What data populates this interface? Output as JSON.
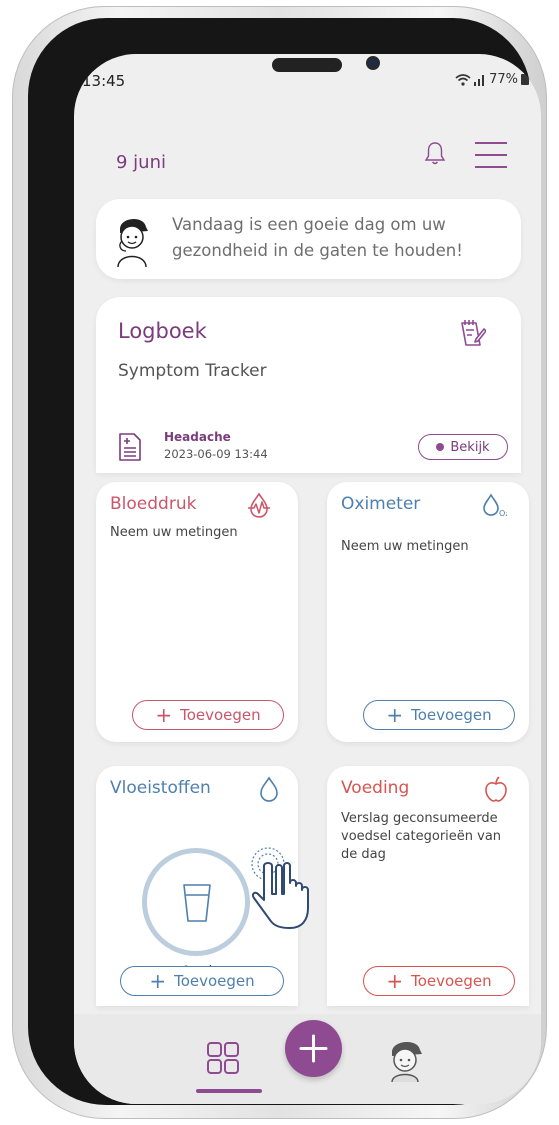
{
  "status_bar": {
    "time": "13:45",
    "battery": "77%"
  },
  "header": {
    "date": "9 juni"
  },
  "greeting": {
    "text": "Vandaag is een goeie dag om uw gezondheid in de gaten te houden!"
  },
  "logbook": {
    "title": "Logboek",
    "subtitle": "Symptom Tracker",
    "entry": {
      "name": "Headache",
      "datetime": "2023-06-09 13:44"
    },
    "view_label": "Bekijk"
  },
  "tiles": {
    "blood_pressure": {
      "title": "Bloeddruk",
      "description": "Neem uw metingen",
      "add_label": "Toevoegen",
      "color": "#c9566a"
    },
    "oximeter": {
      "title": "Oximeter",
      "description": "Neem uw metingen",
      "add_label": "Toevoegen",
      "color": "#4e7fae"
    },
    "fluids": {
      "title": "Vloeistoffen",
      "amount": "0 ml",
      "add_label": "Toevoegen",
      "color": "#4e7fae"
    },
    "nutrition": {
      "title": "Voeding",
      "description": "Verslag geconsumeerde voedsel categorieën van de dag",
      "add_label": "Toevoegen",
      "color": "#d9534f"
    }
  },
  "colors": {
    "primary": "#8e4b92",
    "background": "#efefef"
  },
  "icons": [
    "bell-icon",
    "menu-icon",
    "notebook-edit-icon",
    "document-add-icon",
    "heart-pulse-icon",
    "oxygen-drop-icon",
    "water-drop-icon",
    "glass-icon",
    "apple-icon",
    "tap-gesture-icon",
    "grid-icon",
    "plus-icon",
    "avatar-icon"
  ]
}
